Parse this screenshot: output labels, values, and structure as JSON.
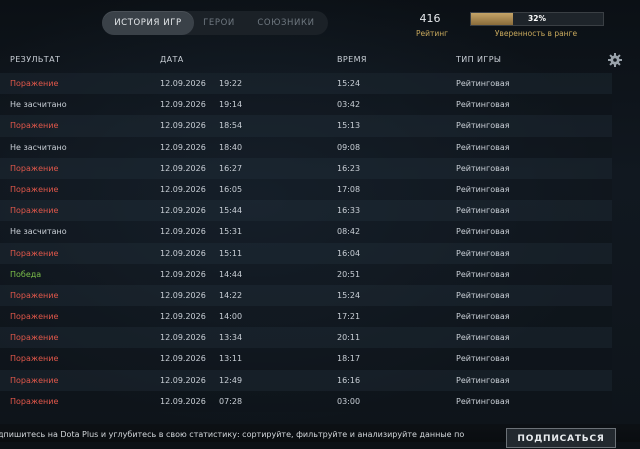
{
  "tabs": [
    {
      "label": "ИСТОРИЯ ИГР",
      "active": true
    },
    {
      "label": "ГЕРОИ",
      "active": false
    },
    {
      "label": "СОЮЗНИКИ",
      "active": false
    }
  ],
  "rating": {
    "value": "416",
    "label": "Рейтинг"
  },
  "confidence": {
    "percent_text": "32%",
    "fraction": 0.32,
    "label": "Уверенность в ранге"
  },
  "columns": {
    "result": "РЕЗУЛЬТАТ",
    "date": "ДАТА",
    "duration": "ВРЕМЯ",
    "type": "ТИП ИГРЫ"
  },
  "icons": {
    "settings": "gear-icon"
  },
  "colors": {
    "loss": "#e0574a",
    "win": "#7bbf4a",
    "neutral": "#c9cfd6",
    "accent": "#c7a85c"
  },
  "matches": [
    {
      "result": "Поражение",
      "outcome": "loss",
      "date": "12.09.2026",
      "time": "19:22",
      "duration": "15:24",
      "type": "Рейтинговая"
    },
    {
      "result": "Не засчитано",
      "outcome": "nc",
      "date": "12.09.2026",
      "time": "19:14",
      "duration": "03:42",
      "type": "Рейтинговая"
    },
    {
      "result": "Поражение",
      "outcome": "loss",
      "date": "12.09.2026",
      "time": "18:54",
      "duration": "15:13",
      "type": "Рейтинговая"
    },
    {
      "result": "Не засчитано",
      "outcome": "nc",
      "date": "12.09.2026",
      "time": "18:40",
      "duration": "09:08",
      "type": "Рейтинговая"
    },
    {
      "result": "Поражение",
      "outcome": "loss",
      "date": "12.09.2026",
      "time": "16:27",
      "duration": "16:23",
      "type": "Рейтинговая"
    },
    {
      "result": "Поражение",
      "outcome": "loss",
      "date": "12.09.2026",
      "time": "16:05",
      "duration": "17:08",
      "type": "Рейтинговая"
    },
    {
      "result": "Поражение",
      "outcome": "loss",
      "date": "12.09.2026",
      "time": "15:44",
      "duration": "16:33",
      "type": "Рейтинговая"
    },
    {
      "result": "Не засчитано",
      "outcome": "nc",
      "date": "12.09.2026",
      "time": "15:31",
      "duration": "08:42",
      "type": "Рейтинговая"
    },
    {
      "result": "Поражение",
      "outcome": "loss",
      "date": "12.09.2026",
      "time": "15:11",
      "duration": "16:04",
      "type": "Рейтинговая"
    },
    {
      "result": "Победа",
      "outcome": "win",
      "date": "12.09.2026",
      "time": "14:44",
      "duration": "20:51",
      "type": "Рейтинговая"
    },
    {
      "result": "Поражение",
      "outcome": "loss",
      "date": "12.09.2026",
      "time": "14:22",
      "duration": "15:24",
      "type": "Рейтинговая"
    },
    {
      "result": "Поражение",
      "outcome": "loss",
      "date": "12.09.2026",
      "time": "14:00",
      "duration": "17:21",
      "type": "Рейтинговая"
    },
    {
      "result": "Поражение",
      "outcome": "loss",
      "date": "12.09.2026",
      "time": "13:34",
      "duration": "20:11",
      "type": "Рейтинговая"
    },
    {
      "result": "Поражение",
      "outcome": "loss",
      "date": "12.09.2026",
      "time": "13:11",
      "duration": "18:17",
      "type": "Рейтинговая"
    },
    {
      "result": "Поражение",
      "outcome": "loss",
      "date": "12.09.2026",
      "time": "12:49",
      "duration": "16:16",
      "type": "Рейтинговая"
    },
    {
      "result": "Поражение",
      "outcome": "loss",
      "date": "12.09.2026",
      "time": "07:28",
      "duration": "03:00",
      "type": "Рейтинговая"
    }
  ],
  "promo": {
    "text": "дпишитесь на Dota Plus и углубитесь в свою статистику: сортируйте, фильтруйте и анализируйте данные по",
    "button": "ПОДПИСАТЬСЯ"
  }
}
